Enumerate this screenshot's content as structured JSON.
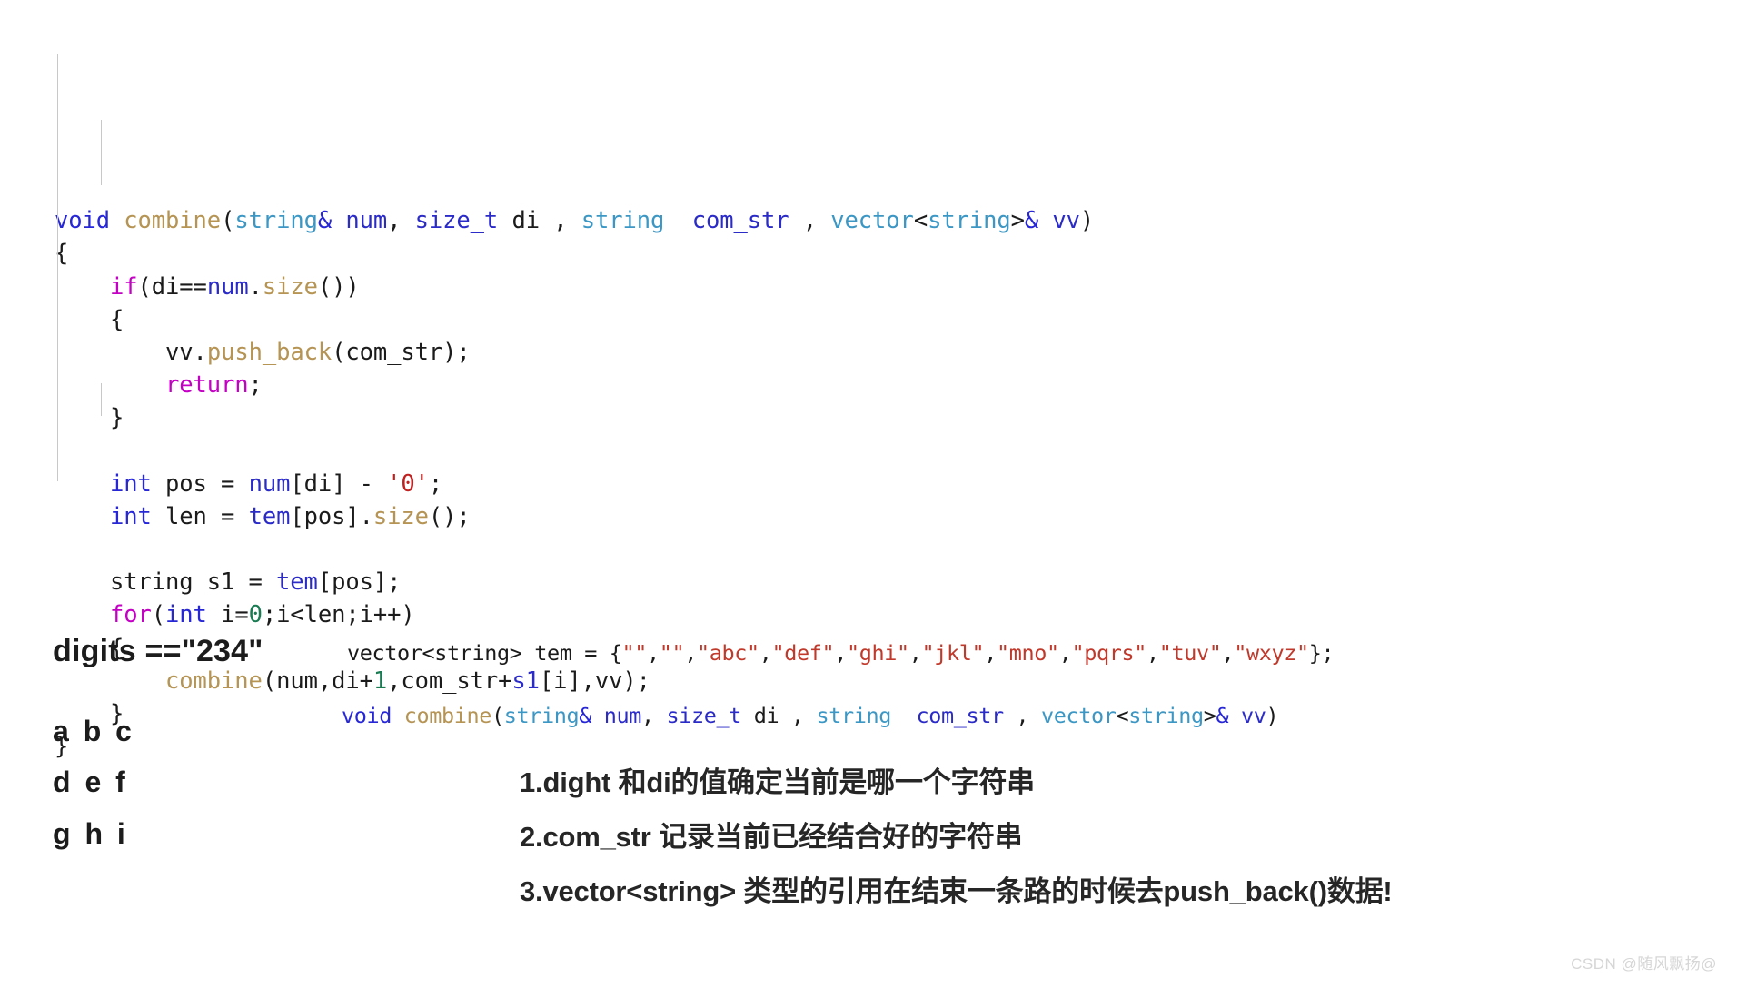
{
  "code_block": {
    "lines": [
      [
        {
          "t": "void",
          "c": "t-void"
        },
        {
          "t": " ",
          "c": "t-plain"
        },
        {
          "t": "combine",
          "c": "t-fn"
        },
        {
          "t": "(",
          "c": "t-plain"
        },
        {
          "t": "string",
          "c": "t-type"
        },
        {
          "t": "&",
          "c": "t-amp"
        },
        {
          "t": " ",
          "c": "t-plain"
        },
        {
          "t": "num",
          "c": "t-var"
        },
        {
          "t": ", ",
          "c": "t-plain"
        },
        {
          "t": "size_t",
          "c": "t-var"
        },
        {
          "t": " ",
          "c": "t-plain"
        },
        {
          "t": "di",
          "c": "t-plain"
        },
        {
          "t": " , ",
          "c": "t-plain"
        },
        {
          "t": "string",
          "c": "t-type"
        },
        {
          "t": "  ",
          "c": "t-plain"
        },
        {
          "t": "com_str",
          "c": "t-var"
        },
        {
          "t": " , ",
          "c": "t-plain"
        },
        {
          "t": "vector",
          "c": "t-type"
        },
        {
          "t": "<",
          "c": "t-plain"
        },
        {
          "t": "string",
          "c": "t-type"
        },
        {
          "t": ">",
          "c": "t-plain"
        },
        {
          "t": "&",
          "c": "t-amp"
        },
        {
          "t": " ",
          "c": "t-plain"
        },
        {
          "t": "vv",
          "c": "t-var"
        },
        {
          "t": ")",
          "c": "t-plain"
        }
      ],
      [
        {
          "t": "{",
          "c": "t-plain"
        }
      ],
      [
        {
          "t": "    ",
          "c": "t-plain"
        },
        {
          "t": "if",
          "c": "t-kw"
        },
        {
          "t": "(",
          "c": "t-plain"
        },
        {
          "t": "di==",
          "c": "t-plain"
        },
        {
          "t": "num",
          "c": "t-var"
        },
        {
          "t": ".",
          "c": "t-plain"
        },
        {
          "t": "size",
          "c": "t-meth"
        },
        {
          "t": "())",
          "c": "t-plain"
        }
      ],
      [
        {
          "t": "    {",
          "c": "t-plain"
        }
      ],
      [
        {
          "t": "        ",
          "c": "t-plain"
        },
        {
          "t": "vv",
          "c": "t-plain"
        },
        {
          "t": ".",
          "c": "t-plain"
        },
        {
          "t": "push_back",
          "c": "t-meth"
        },
        {
          "t": "(com_str);",
          "c": "t-plain"
        }
      ],
      [
        {
          "t": "        ",
          "c": "t-plain"
        },
        {
          "t": "return",
          "c": "t-kw"
        },
        {
          "t": ";",
          "c": "t-plain"
        }
      ],
      [
        {
          "t": "    }",
          "c": "t-plain"
        }
      ],
      [
        {
          "t": "",
          "c": "t-plain"
        }
      ],
      [
        {
          "t": "    ",
          "c": "t-plain"
        },
        {
          "t": "int",
          "c": "t-int"
        },
        {
          "t": " pos = ",
          "c": "t-plain"
        },
        {
          "t": "num",
          "c": "t-var"
        },
        {
          "t": "[di] - ",
          "c": "t-plain"
        },
        {
          "t": "'0'",
          "c": "t-char"
        },
        {
          "t": ";",
          "c": "t-plain"
        }
      ],
      [
        {
          "t": "    ",
          "c": "t-plain"
        },
        {
          "t": "int",
          "c": "t-int"
        },
        {
          "t": " len = ",
          "c": "t-plain"
        },
        {
          "t": "tem",
          "c": "t-var"
        },
        {
          "t": "[pos].",
          "c": "t-plain"
        },
        {
          "t": "size",
          "c": "t-meth"
        },
        {
          "t": "();",
          "c": "t-plain"
        }
      ],
      [
        {
          "t": "",
          "c": "t-plain"
        }
      ],
      [
        {
          "t": "    string s1 = ",
          "c": "t-plain"
        },
        {
          "t": "tem",
          "c": "t-var"
        },
        {
          "t": "[pos];",
          "c": "t-plain"
        }
      ],
      [
        {
          "t": "    ",
          "c": "t-plain"
        },
        {
          "t": "for",
          "c": "t-kw"
        },
        {
          "t": "(",
          "c": "t-plain"
        },
        {
          "t": "int",
          "c": "t-int"
        },
        {
          "t": " i=",
          "c": "t-plain"
        },
        {
          "t": "0",
          "c": "t-num"
        },
        {
          "t": ";i<len;i++)",
          "c": "t-plain"
        }
      ],
      [
        {
          "t": "    {",
          "c": "t-plain"
        }
      ],
      [
        {
          "t": "        ",
          "c": "t-plain"
        },
        {
          "t": "combine",
          "c": "t-fn"
        },
        {
          "t": "(num,di+",
          "c": "t-plain"
        },
        {
          "t": "1",
          "c": "t-num"
        },
        {
          "t": ",com_str+",
          "c": "t-plain"
        },
        {
          "t": "s1",
          "c": "t-var"
        },
        {
          "t": "[i],vv);",
          "c": "t-plain"
        }
      ],
      [
        {
          "t": "    }",
          "c": "t-plain"
        }
      ],
      [
        {
          "t": "}",
          "c": "t-plain"
        }
      ]
    ]
  },
  "lower": {
    "digits_label": "digits ==\"234\"",
    "letters": [
      "a b c",
      "d e f",
      "g h i"
    ],
    "tem_line": [
      {
        "t": "vector<string> tem = {",
        "c": "plain"
      },
      {
        "t": "\"\"",
        "c": "str"
      },
      {
        "t": ",",
        "c": "plain"
      },
      {
        "t": "\"\"",
        "c": "str"
      },
      {
        "t": ",",
        "c": "plain"
      },
      {
        "t": "\"abc\"",
        "c": "str"
      },
      {
        "t": ",",
        "c": "plain"
      },
      {
        "t": "\"def\"",
        "c": "str"
      },
      {
        "t": ",",
        "c": "plain"
      },
      {
        "t": "\"ghi\"",
        "c": "str"
      },
      {
        "t": ",",
        "c": "plain"
      },
      {
        "t": "\"jkl\"",
        "c": "str"
      },
      {
        "t": ",",
        "c": "plain"
      },
      {
        "t": "\"mno\"",
        "c": "str"
      },
      {
        "t": ",",
        "c": "plain"
      },
      {
        "t": "\"pqrs\"",
        "c": "str"
      },
      {
        "t": ",",
        "c": "plain"
      },
      {
        "t": "\"tuv\"",
        "c": "str"
      },
      {
        "t": ",",
        "c": "plain"
      },
      {
        "t": "\"wxyz\"",
        "c": "str"
      },
      {
        "t": "};",
        "c": "plain"
      }
    ],
    "signature_line": [
      {
        "t": "void",
        "c": "t-void"
      },
      {
        "t": " ",
        "c": "t-plain"
      },
      {
        "t": "combine",
        "c": "t-fn"
      },
      {
        "t": "(",
        "c": "t-plain"
      },
      {
        "t": "string",
        "c": "t-type"
      },
      {
        "t": "&",
        "c": "t-amp"
      },
      {
        "t": " ",
        "c": "t-plain"
      },
      {
        "t": "num",
        "c": "t-var"
      },
      {
        "t": ", ",
        "c": "t-plain"
      },
      {
        "t": "size_t",
        "c": "t-var"
      },
      {
        "t": " ",
        "c": "t-plain"
      },
      {
        "t": "di",
        "c": "t-plain"
      },
      {
        "t": " , ",
        "c": "t-plain"
      },
      {
        "t": "string",
        "c": "t-type"
      },
      {
        "t": "  ",
        "c": "t-plain"
      },
      {
        "t": "com_str",
        "c": "t-var"
      },
      {
        "t": " , ",
        "c": "t-plain"
      },
      {
        "t": "vector",
        "c": "t-type"
      },
      {
        "t": "<",
        "c": "t-plain"
      },
      {
        "t": "string",
        "c": "t-type"
      },
      {
        "t": ">",
        "c": "t-plain"
      },
      {
        "t": "&",
        "c": "t-amp"
      },
      {
        "t": " ",
        "c": "t-plain"
      },
      {
        "t": "vv",
        "c": "t-var"
      },
      {
        "t": ")",
        "c": "t-plain"
      }
    ],
    "notes": [
      "1.dight 和di的值确定当前是哪一个字符串",
      "2.com_str 记录当前已经结合好的字符串",
      "3.vector<string> 类型的引用在结束一条路的时候去push_back()数据!"
    ]
  },
  "watermark": "CSDN @随风飘扬@",
  "colors": {
    "background": "#ffffff",
    "keyword": "#c400c4",
    "type": "#3c97c4",
    "function": "#b59454",
    "variable": "#2b2bc8",
    "number": "#1a7a52",
    "char_literal": "#c02020",
    "string_literal": "#c0392b",
    "void_keyword": "#2727d6",
    "plain_text": "#1b1b1b",
    "guide_line": "#c8c8c8",
    "watermark": "#d6d6d6"
  }
}
